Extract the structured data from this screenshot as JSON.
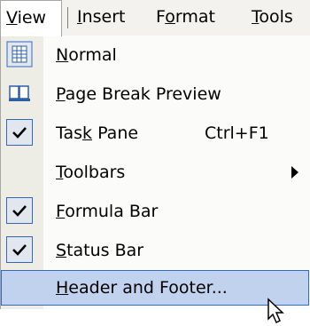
{
  "menubar": {
    "view": "View",
    "insert": "Insert",
    "format": "Format",
    "tools": "Tools"
  },
  "menu": {
    "items": [
      {
        "label": "Normal",
        "icon": "normal-view-icon",
        "checked": false
      },
      {
        "label": "Page Break Preview",
        "icon": "page-break-preview-icon",
        "checked": false
      },
      {
        "label": "Task Pane",
        "shortcut": "Ctrl+F1",
        "icon": "check-icon",
        "checked": true
      },
      {
        "label": "Toolbars",
        "submenu": true,
        "icon": "",
        "checked": false
      },
      {
        "label": "Formula Bar",
        "icon": "check-icon",
        "checked": true
      },
      {
        "label": "Status Bar",
        "icon": "check-icon",
        "checked": true
      },
      {
        "label": "Header and Footer...",
        "icon": "",
        "checked": false,
        "highlighted": true
      }
    ]
  },
  "colors": {
    "highlight": "#c1d2ee",
    "highlight_border": "#316ac5",
    "gutter": "#eeede5"
  }
}
